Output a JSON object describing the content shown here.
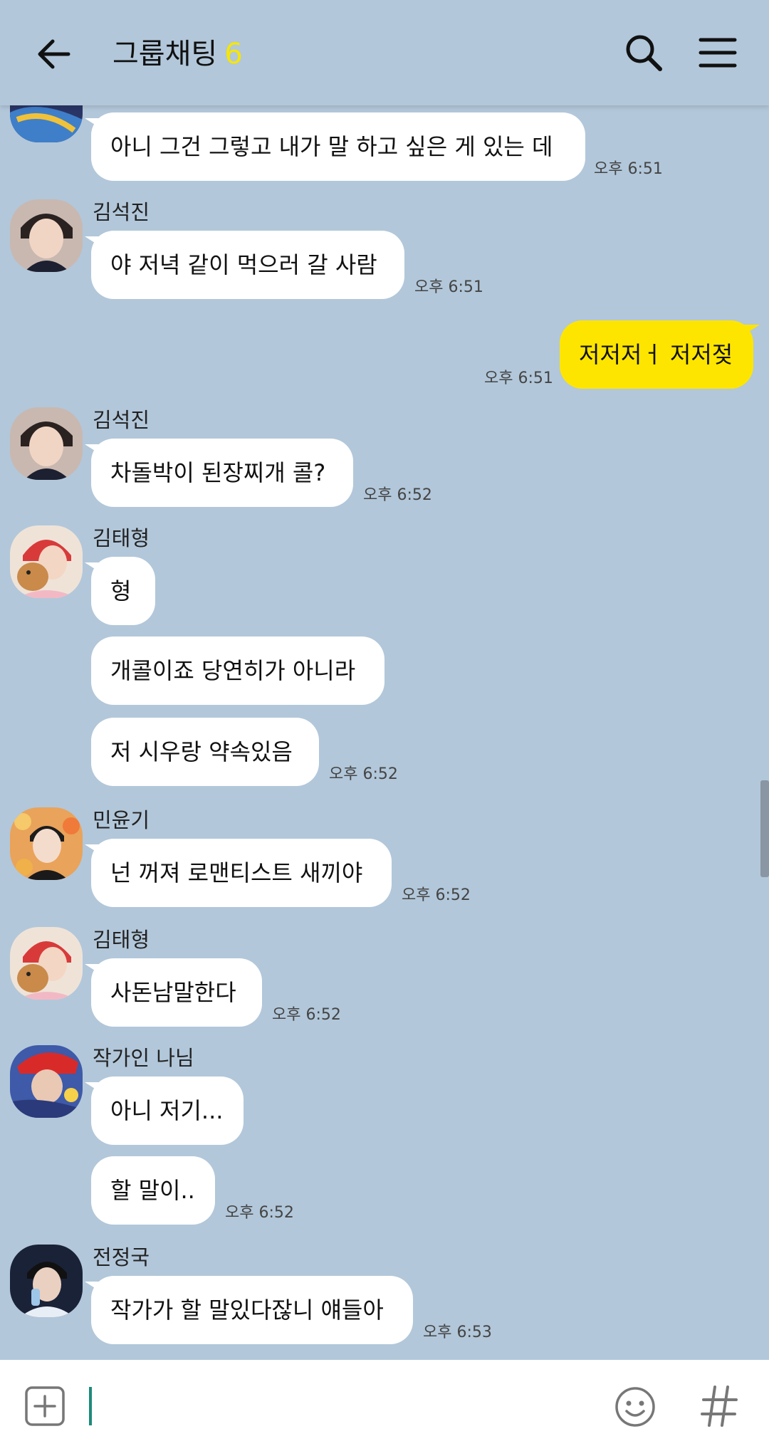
{
  "header": {
    "title": "그룹채팅",
    "member_count": "6",
    "icons": {
      "back": "arrow-left-icon",
      "search": "search-icon",
      "menu": "hamburger-menu-icon"
    },
    "colors": {
      "background": "#b2c7da",
      "count": "#f7e600"
    }
  },
  "messages": [
    {
      "sender": "",
      "text": "아니 그건 그렇고 내가 말 하고 싶은 게 있는 데",
      "time": "오후 6:51"
    },
    {
      "sender": "김석진",
      "text": "야 저녁 같이 먹으러 갈 사람",
      "time": "오후 6:51"
    },
    {
      "sender": "me",
      "text": "저저저ㅓ 저저젖",
      "time": "오후 6:51"
    },
    {
      "sender": "김석진",
      "text": "차돌박이 된장찌개 콜?",
      "time": "오후 6:52"
    },
    {
      "sender": "김태형",
      "texts": [
        "형",
        "개콜이죠 당연히가 아니라",
        "저 시우랑 약속있음"
      ],
      "time": "오후 6:52"
    },
    {
      "sender": "민윤기",
      "text": "넌 꺼져 로맨티스트 새끼야",
      "time": "오후 6:52"
    },
    {
      "sender": "김태형",
      "text": "사돈남말한다",
      "time": "오후 6:52"
    },
    {
      "sender": "작가인 나님",
      "texts": [
        "아니 저기...",
        "할 말이.."
      ],
      "time": "오후 6:52"
    },
    {
      "sender": "전정국",
      "text": "작가가 할 말있다잖니 얘들아",
      "time": "오후 6:53"
    }
  ],
  "input": {
    "value": "",
    "icons": {
      "attach": "plus-box-icon",
      "emoticon": "smiley-icon",
      "hashtag": "hash-icon"
    }
  },
  "colors": {
    "my_bubble": "#fee500",
    "other_bubble": "#ffffff",
    "caret": "#1d8a7a"
  }
}
